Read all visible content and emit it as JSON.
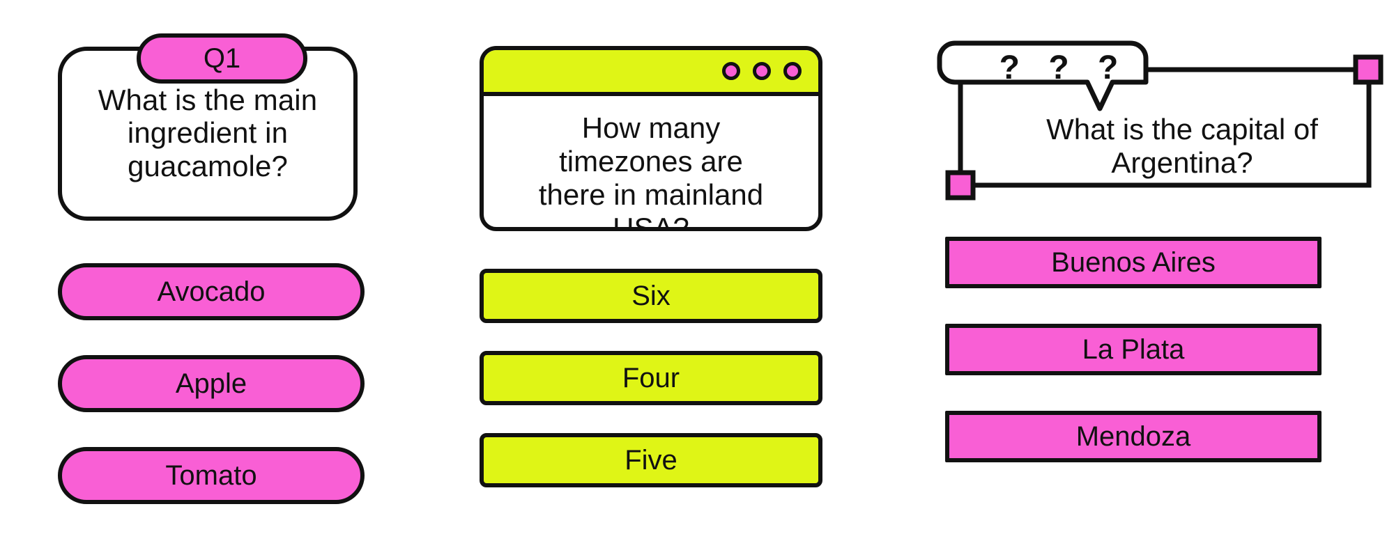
{
  "page": {
    "background_color": "#FFFFFF",
    "accent_pink": "#F95FD5",
    "accent_lime": "#DFF516",
    "outline_color": "#111111"
  },
  "cards": [
    {
      "id": "card-1",
      "style": "rounded-pill-card",
      "badge_label": "Q1",
      "question": "What is the main ingredient in guacamole?",
      "question_lines": [
        "What is the main",
        "ingredient in",
        "guacamole?"
      ],
      "answers": [
        "Avocado",
        "Apple",
        "Tomato"
      ],
      "answer_color": "#F95FD5"
    },
    {
      "id": "card-2",
      "style": "browser-window-card",
      "window_dots": [
        "window-dot-1",
        "window-dot-2",
        "window-dot-3"
      ],
      "question": "How many timezones are there in mainland USA?",
      "question_lines": [
        "How many",
        "timezones are",
        "there in mainland",
        "USA?"
      ],
      "answers": [
        "Six",
        "Four",
        "Five"
      ],
      "answer_color": "#DFF516",
      "titlebar_color": "#DFF516"
    },
    {
      "id": "card-3",
      "style": "speech-bubble-frame-card",
      "badge_label": "? ? ?",
      "question": "What is the capital of Argentina?",
      "question_lines": [
        "What is the capital of",
        "Argentina?"
      ],
      "answers": [
        "Buenos Aires",
        "La Plata",
        "Mendoza"
      ],
      "answer_color": "#F95FD5",
      "corner_markers": [
        "corner-marker-top-right",
        "corner-marker-bottom-left"
      ]
    }
  ]
}
